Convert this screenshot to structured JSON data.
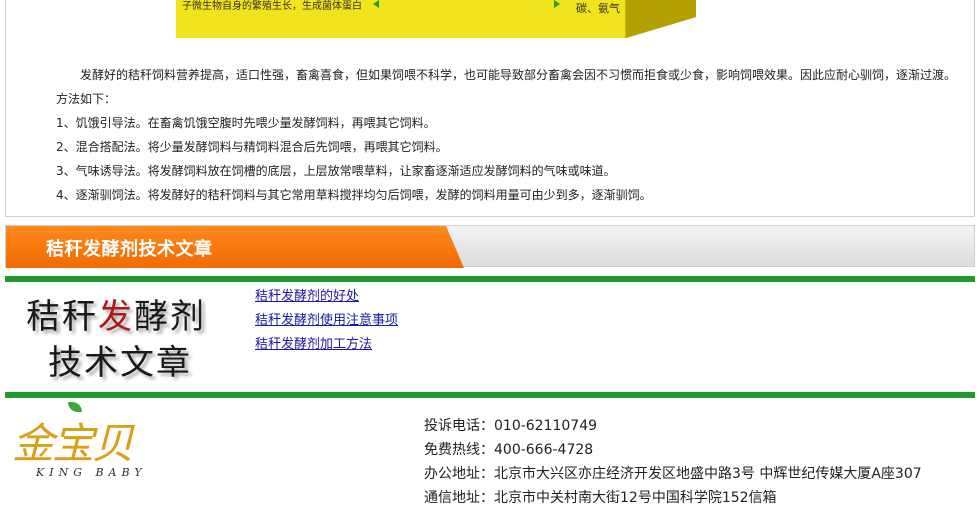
{
  "banner": {
    "left_text": "子微生物自身的繁殖生长，生成菌体蛋白",
    "right_text": "碳、氨气"
  },
  "article": {
    "intro": "发酵好的秸秆饲料营养提高，适口性强，畜禽喜食，但如果饲喂不科学，也可能导致部分畜禽会因不习惯而拒食或少食，影响饲喂效果。因此应耐心驯饲，逐渐过渡。",
    "methods_heading": "方法如下：",
    "methods": [
      "1、饥饿引导法。在畜禽饥饿空腹时先喂少量发酵饲料，再喂其它饲料。",
      "2、混合搭配法。将少量发酵饲料与精饲料混合后先饲喂，再喂其它饲料。",
      "3、气味诱导法。将发酵饲料放在饲槽的底层，上层放常喂草料，让家畜逐渐适应发酵饲料的气味或味道。",
      "4、逐渐驯饲法。将发酵好的秸秆饲料与其它常用草料搅拌均匀后饲喂，发酵的饲料用量可由少到多，逐渐驯饲。"
    ]
  },
  "section": {
    "title": "秸秆发酵剂技术文章"
  },
  "calligraphy": {
    "line1_a": "秸秆",
    "line1_b": "发",
    "line1_c": "酵剂",
    "line2": "技术文章"
  },
  "links": [
    "秸秆发酵剂的好处",
    "秸秆发酵剂使用注意事项",
    "秸秆发酵剂加工方法"
  ],
  "logo": {
    "text": "金宝贝",
    "sub": "KING BABY"
  },
  "contact": {
    "complaint_label": "投诉电话：",
    "complaint_value": "010-62110749",
    "hotline_label": "免费热线：",
    "hotline_value": "400-666-4728",
    "office_label": "办公地址：",
    "office_value": "北京市大兴区亦庄经济开发区地盛中路3号 中辉世纪传媒大厦A座307",
    "mail_label": "通信地址：",
    "mail_value": "北京市中关村南大街12号中国科学院152信箱"
  },
  "colors": {
    "accent_orange": "#f06a00",
    "rule_green": "#1f9a2f",
    "link_blue": "#1a1aa6",
    "banner_yellow": "#f2e41c"
  }
}
